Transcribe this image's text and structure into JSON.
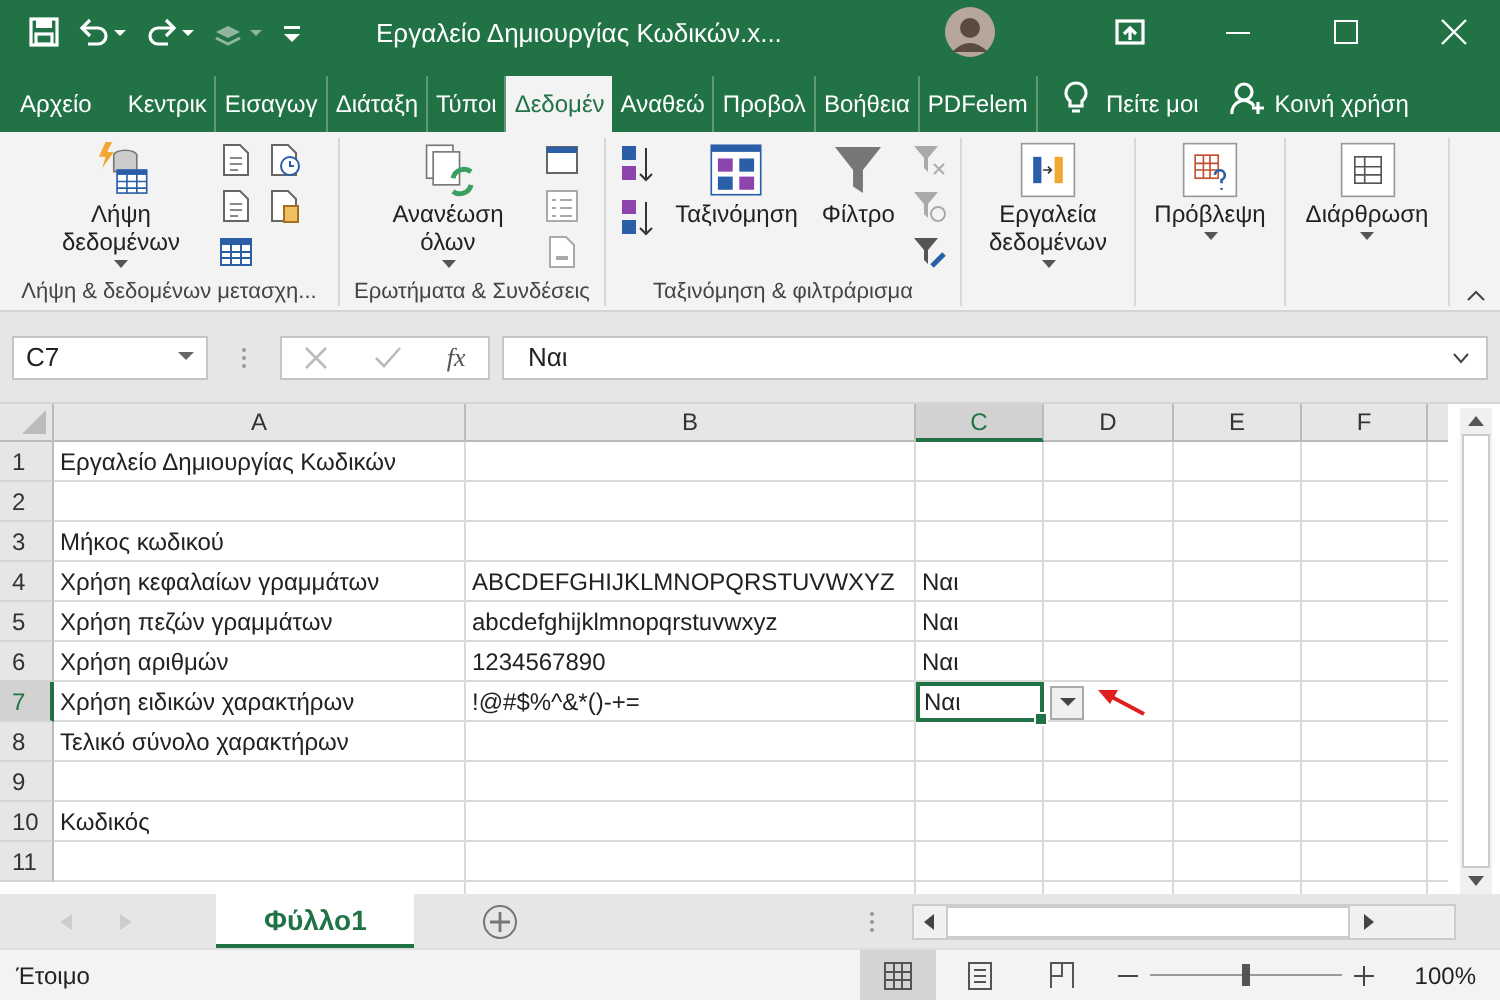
{
  "window": {
    "title": "Εργαλείο Δημιουργίας Κωδικών.x..."
  },
  "tabs": [
    {
      "label": "Αρχείο",
      "selected": false
    },
    {
      "label": "Κεντρικ",
      "selected": false
    },
    {
      "label": "Εισαγωγ",
      "selected": false
    },
    {
      "label": "Διάταξη",
      "selected": false
    },
    {
      "label": "Τύποι",
      "selected": false
    },
    {
      "label": "Δεδομέν",
      "selected": true
    },
    {
      "label": "Αναθεώ",
      "selected": false
    },
    {
      "label": "Προβολ",
      "selected": false
    },
    {
      "label": "Βοήθεια",
      "selected": false
    },
    {
      "label": "PDFelem",
      "selected": false
    }
  ],
  "tell_me": "Πείτε μοι",
  "share": "Κοινή χρήση",
  "ribbon_groups": [
    {
      "label": "Λήψη & δεδομένων μετασχη...",
      "kind": "get",
      "buttons": [
        "Λήψη δεδομένων"
      ]
    },
    {
      "label": "Ερωτήματα & Συνδέσεις",
      "kind": "queries",
      "buttons": [
        "Ανανέωση όλων"
      ]
    },
    {
      "label": "Ταξινόμηση & φιλτράρισμα",
      "kind": "sort",
      "buttons": [
        "Ταξινόμηση",
        "Φίλτρο"
      ]
    },
    {
      "kind": "tools",
      "buttons": [
        "Εργαλεία δεδομένων"
      ]
    },
    {
      "kind": "forecast",
      "buttons": [
        "Πρόβλεψη"
      ]
    },
    {
      "kind": "outline",
      "buttons": [
        "Διάρθρωση"
      ]
    }
  ],
  "formula_bar": {
    "name_box": "C7",
    "fx": "fx",
    "value": "Ναι"
  },
  "columns": [
    {
      "label": "A",
      "selected": false
    },
    {
      "label": "B",
      "selected": false
    },
    {
      "label": "C",
      "selected": true
    },
    {
      "label": "D",
      "selected": false
    },
    {
      "label": "E",
      "selected": false
    },
    {
      "label": "F",
      "selected": false
    }
  ],
  "rows": [
    {
      "number": "1",
      "selected": false,
      "cells": [
        {
          "text": "Εργαλείο Δημιουργίας Κωδικών",
          "selected": false
        }
      ]
    },
    {
      "number": "2",
      "selected": false,
      "cells": []
    },
    {
      "number": "3",
      "selected": false,
      "cells": [
        {
          "text": "Μήκος κωδικού",
          "selected": false
        }
      ]
    },
    {
      "number": "4",
      "selected": false,
      "cells": [
        {
          "text": "Χρήση κεφαλαίων γραμμάτων",
          "selected": false
        },
        {
          "text": "ABCDEFGHIJKLMNOPQRSTUVWXYZ",
          "selected": false
        },
        {
          "text": "Ναι",
          "selected": false
        }
      ]
    },
    {
      "number": "5",
      "selected": false,
      "cells": [
        {
          "text": "Χρήση πεζών γραμμάτων",
          "selected": false
        },
        {
          "text": "abcdefghijklmnopqrstuvwxyz",
          "selected": false
        },
        {
          "text": "Ναι",
          "selected": false
        }
      ]
    },
    {
      "number": "6",
      "selected": false,
      "cells": [
        {
          "text": "Χρήση αριθμών",
          "selected": false
        },
        {
          "text": "1234567890",
          "selected": false
        },
        {
          "text": "Ναι",
          "selected": false
        }
      ]
    },
    {
      "number": "7",
      "selected": true,
      "cells": [
        {
          "text": "Χρήση ειδικών χαρακτήρων",
          "selected": false
        },
        {
          "text": "!@#$%^&*()-+=",
          "selected": false
        },
        {
          "text": "Ναι",
          "selected": true,
          "dropdown": true
        }
      ]
    },
    {
      "number": "8",
      "selected": false,
      "cells": [
        {
          "text": "Τελικό σύνολο χαρακτήρων",
          "selected": false
        }
      ]
    },
    {
      "number": "9",
      "selected": false,
      "cells": []
    },
    {
      "number": "10",
      "selected": false,
      "cells": [
        {
          "text": "Κωδικός",
          "selected": false
        }
      ]
    },
    {
      "number": "11",
      "selected": false,
      "cells": []
    }
  ],
  "sheet_tabs": [
    {
      "label": "Φύλλο1",
      "selected": true
    }
  ],
  "status": {
    "text": "Έτοιμο",
    "views": [
      {
        "kind": "normal",
        "selected": true
      },
      {
        "kind": "layout",
        "selected": false
      },
      {
        "kind": "pagebreak",
        "selected": false
      }
    ],
    "level": 0.5,
    "zoom": "100%"
  }
}
